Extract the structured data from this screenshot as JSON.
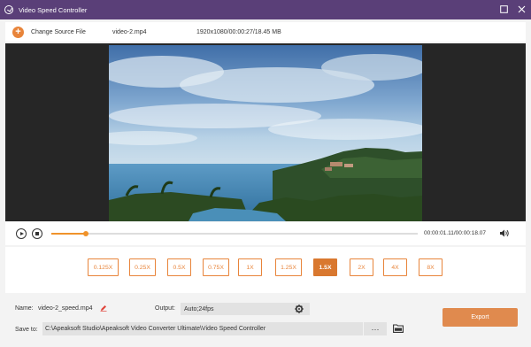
{
  "window": {
    "title": "Video Speed Controller"
  },
  "source": {
    "change_label": "Change Source File",
    "file_name": "video-2.mp4",
    "file_info": "1920x1080/00:00:27/18.45 MB"
  },
  "playback": {
    "timecode": "00:00:01.11/00:00:18.07",
    "progress_fraction": 0.093
  },
  "speeds": {
    "options": [
      "0.125X",
      "0.25X",
      "0.5X",
      "0.75X",
      "1X",
      "1.25X",
      "1.5X",
      "2X",
      "4X",
      "8X"
    ],
    "selected": "1.5X"
  },
  "output": {
    "name_label": "Name:",
    "name_value": "video-2_speed.mp4",
    "output_label": "Output:",
    "output_value": "Auto;24fps",
    "save_label": "Save to:",
    "save_path": "C:\\Apeaksoft Studio\\Apeaksoft Video Converter Ultimate\\Video Speed Controller",
    "browse_label": "···",
    "export_label": "Export"
  },
  "colors": {
    "accent": "#e8843a",
    "titlebar": "#5a3f78",
    "selected_speed": "#d9782f",
    "export": "#e08a4e"
  }
}
